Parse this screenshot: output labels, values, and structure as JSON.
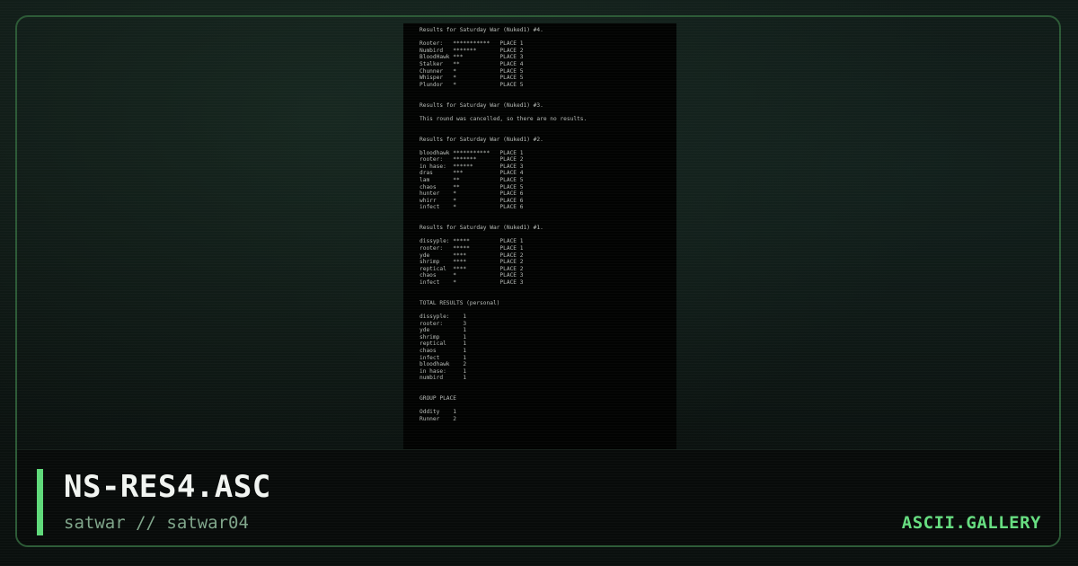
{
  "document": {
    "text": "Results for Saturday War (Nuked1) #4.\n\nRooter:   ***********   PLACE 1\nNumbird   *******       PLACE 2\nBloodHawk ***           PLACE 3\nStalker   **            PLACE 4\nChunner   *             PLACE 5\nWhisper   *             PLACE 5\nPlundor   *             PLACE 5\n\n\nResults for Saturday War (Nuked1) #3.\n\nThis round was cancelled, so there are no results.\n\n\nResults for Saturday War (Nuked1) #2.\n\nbloodhawk ***********   PLACE 1\nrooter:   *******       PLACE 2\nin hase:  ******        PLACE 3\ndras      ***           PLACE 4\nlam       **            PLACE 5\nchaos     **            PLACE 5\nhunter    *             PLACE 6\nwhirr     *             PLACE 6\ninfect    *             PLACE 6\n\n\nResults for Saturday War (Nuked1) #1.\n\ndissyple: *****         PLACE 1\nrooter:   *****         PLACE 1\nyde       ****          PLACE 2\nshrimp    ****          PLACE 2\nreptical  ****          PLACE 2\nchaos     *             PLACE 3\ninfect    *             PLACE 3\n\n\nTOTAL RESULTS (personal)\n\ndissyple:    1\nrooter:      3\nyde          1\nshrimp       1\nreptical     1\nchaos        1\ninfect       1\nbloodhawk    2\nin hase:     1\nnumbird      1\n\n\nGROUP PLACE\n\nOddity    1\nRunner    2"
  },
  "footer": {
    "title": "NS-RES4.ASC",
    "subtitle": "satwar // satwar04",
    "brand": "ASCII.GALLERY"
  },
  "colors": {
    "accent": "#5fd97a",
    "brand": "#66dd80",
    "frame_border": "#2c5a36"
  }
}
